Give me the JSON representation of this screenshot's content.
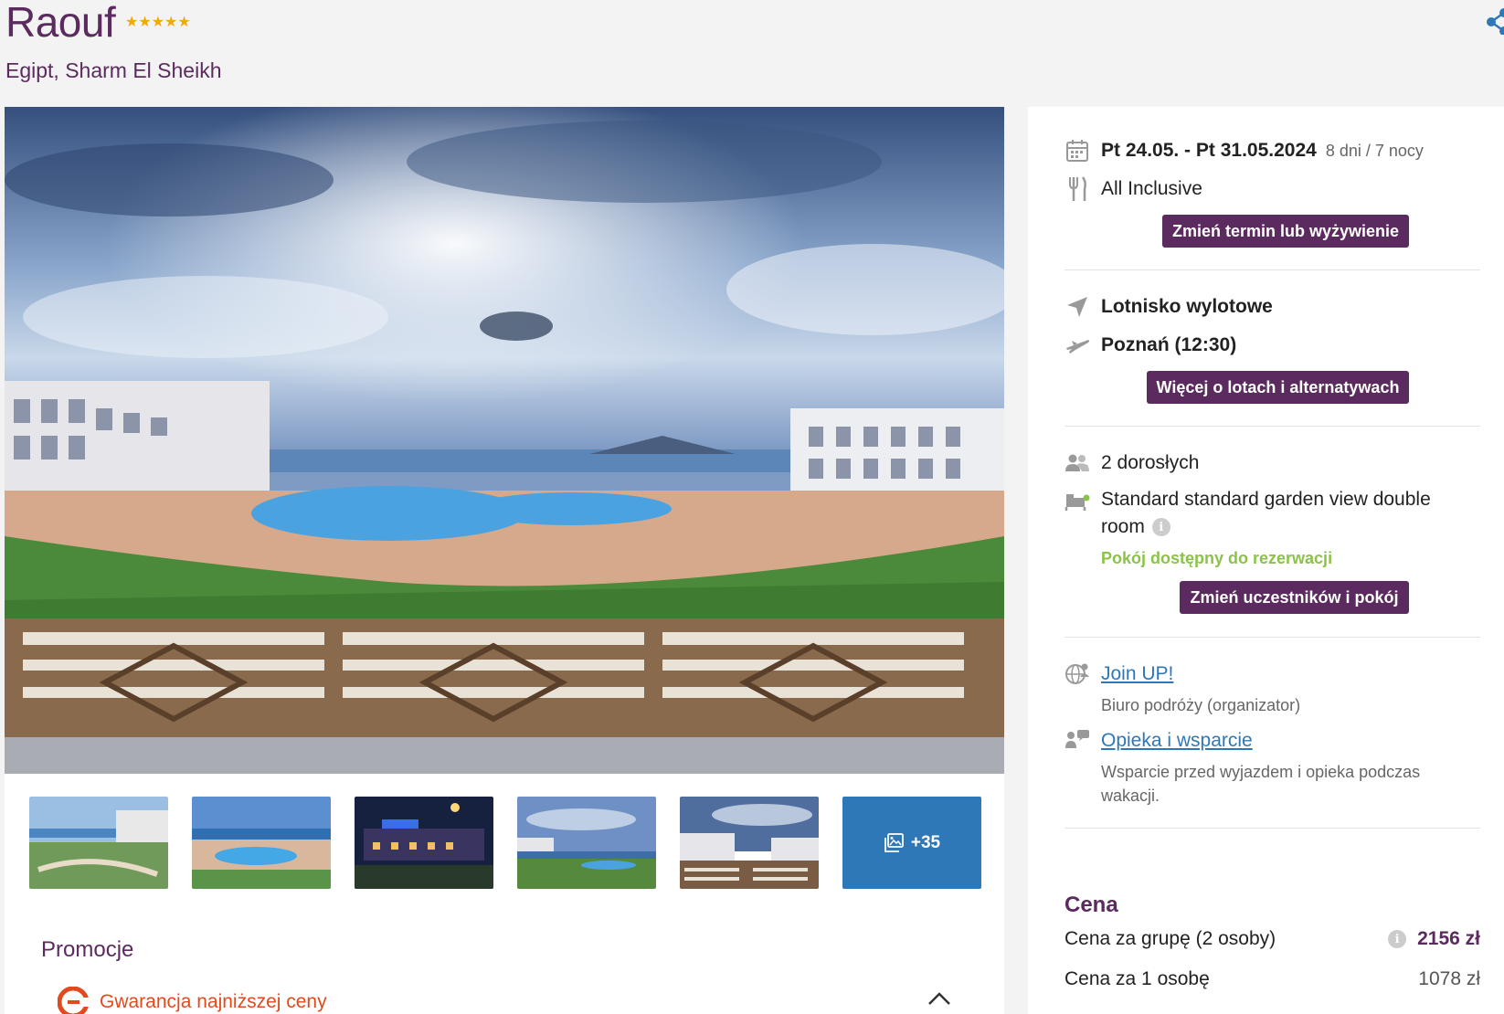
{
  "hotel": {
    "name": "Raouf",
    "stars": "★★★★★",
    "location": "Egipt, Sharm El Sheikh"
  },
  "gallery": {
    "more_count": "+35"
  },
  "promo": {
    "title": "Promocje",
    "item_label": "Gwarancja najniższej ceny"
  },
  "trip": {
    "dates": "Pt 24.05. - Pt 31.05.2024",
    "duration": "8 dni / 7 nocy",
    "board": "All Inclusive",
    "change_button": "Zmień termin lub wyżywienie"
  },
  "flight": {
    "airport_label": "Lotnisko wylotowe",
    "departure": "Poznań (12:30)",
    "more_button": "Więcej o lotach i alternatywach"
  },
  "room": {
    "participants": "2 dorosłych",
    "room_name": "Standard standard garden view double",
    "room_name_2": "room",
    "availability": "Pokój dostępny do rezerwacji",
    "change_button": "Zmień uczestników i pokój"
  },
  "organizer": {
    "name": "Join UP!",
    "role": "Biuro podróży (organizator)",
    "support_link": "Opieka i wsparcie",
    "support_desc_1": "Wsparcie przed wyjazdem i opieka podczas",
    "support_desc_2": "wakacji."
  },
  "price": {
    "title": "Cena",
    "group_label": "Cena za grupę (2 osoby)",
    "group_value": "2156 zł",
    "person_label": "Cena za 1 osobę",
    "person_value": "1078 zł"
  },
  "colors": {
    "brand": "#5b2a5e",
    "link": "#2f78b8",
    "available": "#8bc34a",
    "promo": "#e24a1e",
    "stars": "#f2a900"
  }
}
